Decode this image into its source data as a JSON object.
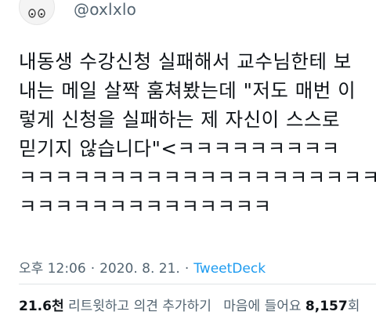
{
  "user": {
    "handle": "@oxlxlo"
  },
  "tweet": {
    "lines": [
      "내동생 수강신청 실패해서 교수님한테 보",
      "내는 메일 살짝 훔쳐봤는데 \"저도 매번 이",
      "렇게 신청을 실패하는 제 자신이 스스로",
      "믿기지 않습니다\"<ㅋㅋㅋㅋㅋㅋㅋㅋㅋ",
      "ㅋㅋㅋㅋㅋㅋㅋㅋㅋㅋㅋㅋㅋㅋㅋㅋㅋㅋㅋㅋ",
      "ㅋㅋㅋㅋㅋㅋㅋㅋㅋㅋㅋㅋㅋㅋ"
    ]
  },
  "meta": {
    "time": "오후 12:06",
    "date": "2020. 8. 21.",
    "source": "TweetDeck"
  },
  "stats": {
    "retweets_count": "21.6천",
    "retweets_label": "리트윗하고 의견 추가하기",
    "likes_label": "마음에 들어요",
    "likes_count": "8,157",
    "likes_unit": "회"
  }
}
